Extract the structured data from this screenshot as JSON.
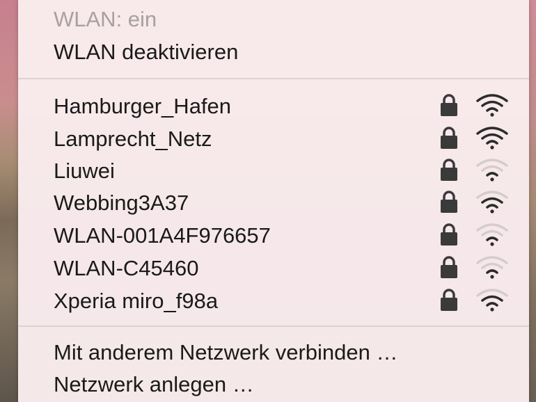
{
  "status": {
    "wlan_state": "WLAN: ein",
    "toggle_label": "WLAN deaktivieren"
  },
  "networks": [
    {
      "name": "Hamburger_Hafen",
      "secured": true,
      "signal": 3
    },
    {
      "name": "Lamprecht_Netz",
      "secured": true,
      "signal": 3
    },
    {
      "name": "Liuwei",
      "secured": true,
      "signal": 1
    },
    {
      "name": "Webbing3A37",
      "secured": true,
      "signal": 2
    },
    {
      "name": "WLAN-001A4F976657",
      "secured": true,
      "signal": 1
    },
    {
      "name": "WLAN-C45460",
      "secured": true,
      "signal": 1
    },
    {
      "name": "Xperia miro_f98a",
      "secured": true,
      "signal": 2
    }
  ],
  "actions": {
    "join_other": "Mit anderem Netzwerk verbinden …",
    "create_network": "Netzwerk anlegen …"
  },
  "icons": {
    "lock": "lock-icon",
    "wifi": "wifi-signal-icon"
  },
  "colors": {
    "menu_bg": "#faecee",
    "text": "#1a1a1a",
    "disabled_text": "#a8a0a2",
    "icon_active": "#2b2b2b",
    "icon_inactive": "#d6cccd"
  }
}
